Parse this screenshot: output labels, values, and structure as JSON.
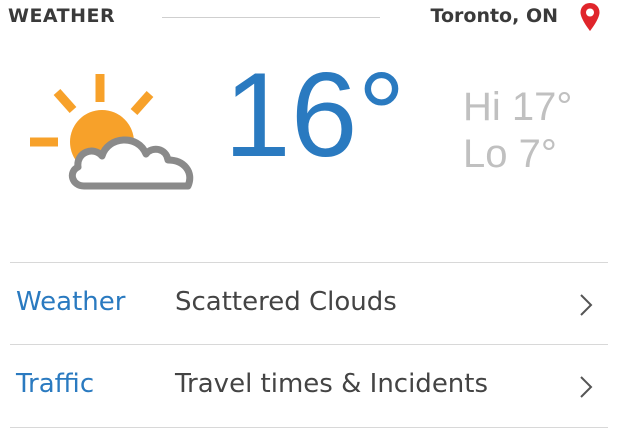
{
  "header": {
    "title": "WEATHER",
    "location": "Toronto, ON",
    "pin_icon": "map-pin-icon",
    "pin_color": "#e0252b"
  },
  "current": {
    "icon": "partly-cloudy-icon",
    "temperature": "16°",
    "hi": "Hi 17°",
    "lo": "Lo 7°",
    "temp_color": "#2a7ac0"
  },
  "rows": [
    {
      "label": "Weather",
      "value": "Scattered Clouds",
      "icon": "chevron-right-icon"
    },
    {
      "label": "Traffic",
      "value": "Travel times & Incidents",
      "icon": "chevron-right-icon"
    }
  ],
  "colors": {
    "accent": "#2a7ac0",
    "sun": "#f7a12a",
    "cloud": "#8a8a8a",
    "muted": "#c0c0c0"
  }
}
